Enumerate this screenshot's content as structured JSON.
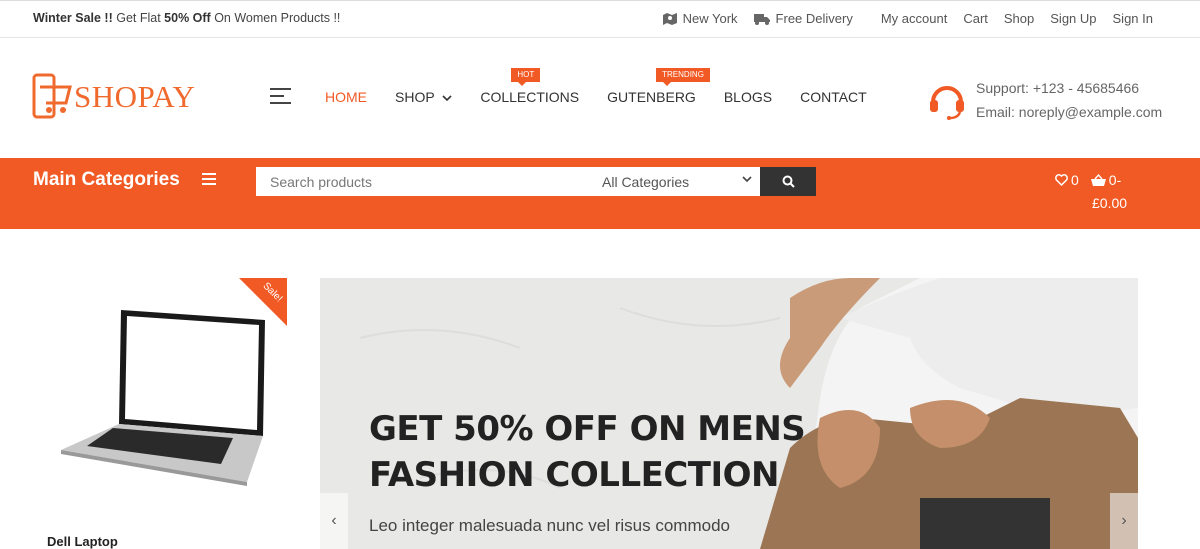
{
  "topbar": {
    "promo_bold": "Winter Sale !!",
    "promo_mid": " Get Flat ",
    "promo_pct": "50% Off",
    "promo_end": " On Women Products !!",
    "location": "New York",
    "delivery": "Free Delivery",
    "links": [
      "My account",
      "Cart",
      "Shop",
      "Sign Up",
      "Sign In"
    ]
  },
  "header": {
    "logo": "SHOPAY",
    "nav": [
      {
        "label": "HOME",
        "active": true
      },
      {
        "label": "SHOP",
        "dropdown": true
      },
      {
        "label": "COLLECTIONS",
        "badge": "HOT"
      },
      {
        "label": "GUTENBERG",
        "badge": "TRENDING"
      },
      {
        "label": "BLOGS"
      },
      {
        "label": "CONTACT"
      }
    ],
    "support": "Support: +123 - 45685466",
    "email": "Email: noreply@example.com"
  },
  "catbar": {
    "title": "Main Categories",
    "search_placeholder": "Search products",
    "category_select": "All Categories",
    "wishlist_count": "0",
    "cart_count": "0-",
    "cart_total": "£0.00"
  },
  "product": {
    "sale_label": "Sale!",
    "name": "Dell Laptop"
  },
  "banner": {
    "headline_1": "GET 50% OFF ON MENS",
    "headline_2": "FASHION COLLECTION",
    "subtitle": "Leo integer malesuada nunc vel risus commodo"
  },
  "colors": {
    "accent": "#f15a24",
    "dark": "#333333"
  },
  "icons": [
    "map-icon",
    "truck-icon",
    "headset-icon",
    "search-icon",
    "heart-icon",
    "basket-icon",
    "menu-icon",
    "chevron-left-icon",
    "chevron-right-icon"
  ]
}
